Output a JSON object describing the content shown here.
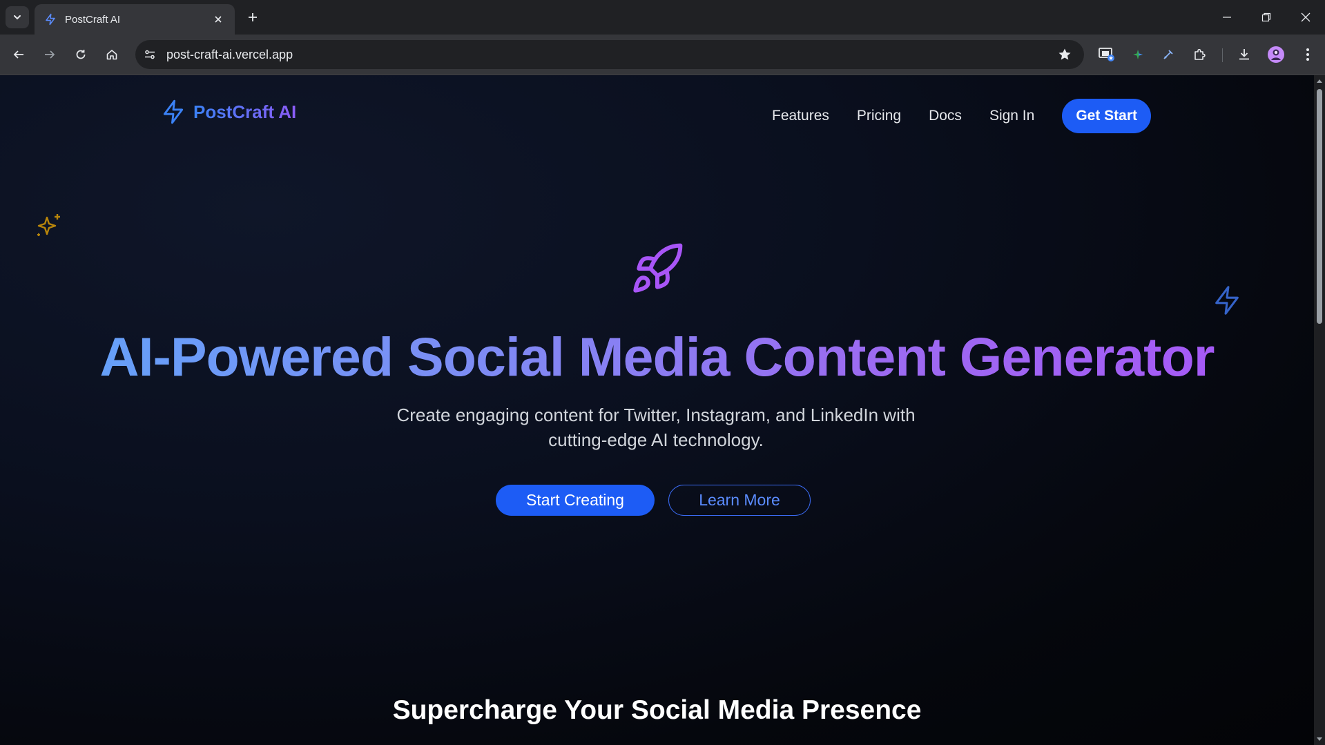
{
  "browser": {
    "tab_title": "PostCraft AI",
    "url": "post-craft-ai.vercel.app",
    "icons": {
      "tab_search": "chevron-down-icon",
      "tab_close": "close-icon",
      "new_tab": "plus-icon",
      "back": "back-arrow-icon",
      "forward": "forward-arrow-icon",
      "reload": "reload-icon",
      "home": "home-icon",
      "site_info": "site-settings-icon",
      "bookmark": "star-icon",
      "extensions": "puzzle-icon",
      "downloads": "download-icon",
      "menu": "kebab-menu-icon"
    }
  },
  "site": {
    "brand": "PostCraft AI",
    "nav": {
      "features": "Features",
      "pricing": "Pricing",
      "docs": "Docs",
      "sign_in": "Sign In",
      "get_start": "Get Start"
    },
    "hero": {
      "title": "AI-Powered Social Media Content Generator",
      "subtitle": "Create engaging content for Twitter, Instagram, and LinkedIn with cutting-edge AI technology.",
      "primary_cta": "Start Creating",
      "secondary_cta": "Learn More"
    },
    "section_heading": "Supercharge Your Social Media Presence",
    "colors": {
      "accent_blue": "#1d5cf5",
      "gradient_start": "#60a5fa",
      "gradient_end": "#a855f7",
      "sparkle": "#b8860b",
      "rocket": "#a855f7"
    }
  }
}
